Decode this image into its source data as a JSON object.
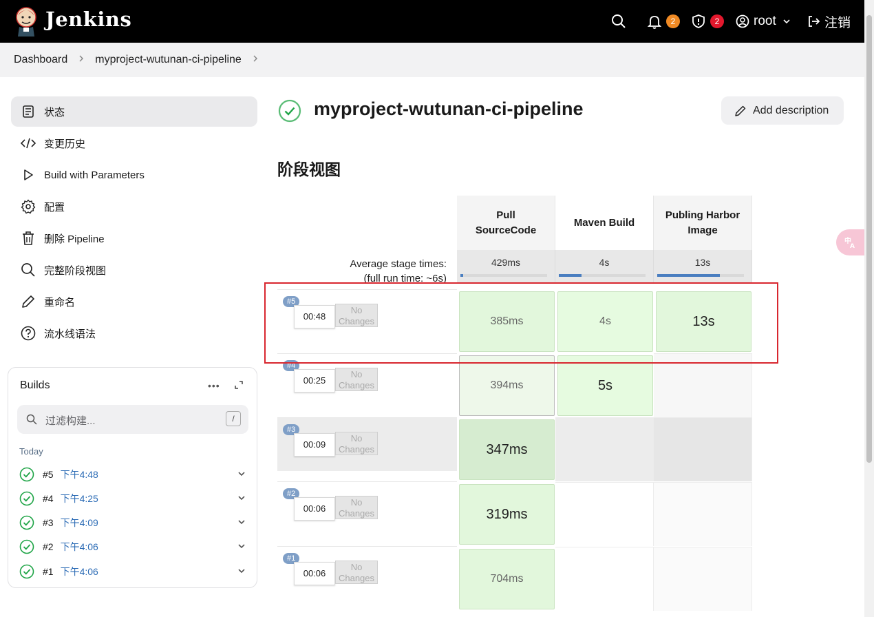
{
  "header": {
    "brand": "Jenkins",
    "notifications_count": "2",
    "security_count": "2",
    "user": "root",
    "logout": "注销",
    "notif_badge_color": "#f08a24",
    "security_badge_color": "#e3182d"
  },
  "breadcrumb": {
    "items": [
      "Dashboard",
      "myproject-wutunan-ci-pipeline"
    ]
  },
  "sidebar": {
    "items": [
      {
        "label": "状态",
        "icon": "document-icon"
      },
      {
        "label": "变更历史",
        "icon": "code-icon"
      },
      {
        "label": "Build with Parameters",
        "icon": "play-icon"
      },
      {
        "label": "配置",
        "icon": "gear-icon"
      },
      {
        "label": "删除 Pipeline",
        "icon": "trash-icon"
      },
      {
        "label": "完整阶段视图",
        "icon": "search-icon"
      },
      {
        "label": "重命名",
        "icon": "pencil-icon"
      },
      {
        "label": "流水线语法",
        "icon": "help-icon"
      }
    ]
  },
  "builds": {
    "title": "Builds",
    "filter_placeholder": "过滤构建...",
    "filter_shortcut": "/",
    "group_label": "Today",
    "items": [
      {
        "number": "#5",
        "time": "下午4:48"
      },
      {
        "number": "#4",
        "time": "下午4:25"
      },
      {
        "number": "#3",
        "time": "下午4:09"
      },
      {
        "number": "#2",
        "time": "下午4:06"
      },
      {
        "number": "#1",
        "time": "下午4:06"
      }
    ]
  },
  "main": {
    "title": "myproject-wutunan-ci-pipeline",
    "add_description": "Add description",
    "section_title": "阶段视图"
  },
  "stage_view": {
    "stages": [
      "Pull SourceCode",
      "Maven Build",
      "Publing Harbor Image"
    ],
    "avg_label_line1": "Average stage times:",
    "avg_label_line2": "(full run time: ~6s)",
    "avg_times": [
      "429ms",
      "4s",
      "13s"
    ],
    "avg_fill_fraction": [
      0.03,
      0.26,
      0.72
    ],
    "no_changes": "No Changes",
    "runs": [
      {
        "number": "#5",
        "duration": "00:48",
        "stages": [
          "385ms",
          "4s",
          "13s"
        ]
      },
      {
        "number": "#4",
        "duration": "00:25",
        "stages": [
          "394ms",
          "5s",
          ""
        ]
      },
      {
        "number": "#3",
        "duration": "00:09",
        "stages": [
          "347ms",
          "",
          ""
        ]
      },
      {
        "number": "#2",
        "duration": "00:06",
        "stages": [
          "319ms",
          "",
          ""
        ]
      },
      {
        "number": "#1",
        "duration": "00:06",
        "stages": [
          "704ms",
          "",
          ""
        ]
      }
    ],
    "success_color": "#e2f7dc"
  }
}
